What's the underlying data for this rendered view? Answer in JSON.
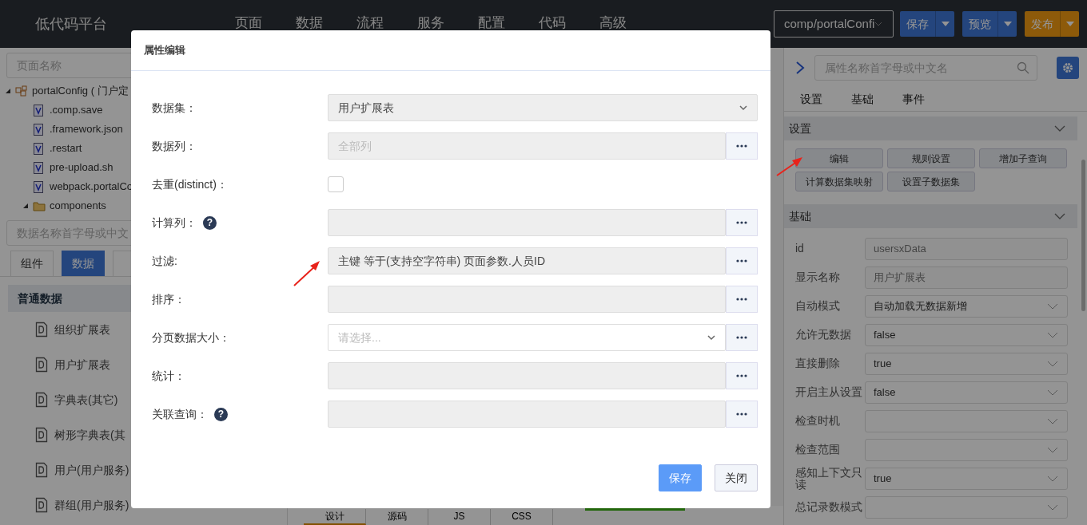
{
  "topbar": {
    "title": "低代码平台",
    "menu": [
      {
        "label": "页面"
      },
      {
        "label": "数据"
      },
      {
        "label": "流程"
      },
      {
        "label": "服务"
      },
      {
        "label": "配置"
      },
      {
        "label": "代码"
      },
      {
        "label": "高级"
      }
    ],
    "path_select": "comp/portalConfi",
    "actions": [
      {
        "label": "保存",
        "kind": "primary"
      },
      {
        "label": "预览",
        "kind": "primary"
      },
      {
        "label": "发布",
        "kind": "warning"
      }
    ]
  },
  "left_panel": {
    "page_search": {
      "placeholder": "页面名称"
    },
    "tree": [
      {
        "label": "portalConfig ( 门户定",
        "kind": "package",
        "expanded": true,
        "children": [
          {
            "label": ".comp.save",
            "kind": "file"
          },
          {
            "label": ".framework.json",
            "kind": "file"
          },
          {
            "label": ".restart",
            "kind": "file"
          },
          {
            "label": "pre-upload.sh",
            "kind": "file"
          },
          {
            "label": "webpack.portalCo",
            "kind": "file"
          },
          {
            "label": "components",
            "kind": "folder",
            "expanded": true
          }
        ]
      }
    ],
    "data_search": {
      "placeholder": "数据名称首字母或中文"
    },
    "tabs": [
      {
        "label": "组件",
        "selected": false
      },
      {
        "label": "数据",
        "selected": true
      },
      {
        "selected": false
      }
    ],
    "group": "普通数据",
    "items": [
      {
        "label": "组织扩展表"
      },
      {
        "label": "用户扩展表"
      },
      {
        "label": "字典表(其它)"
      },
      {
        "label": "树形字典表(其"
      },
      {
        "label": "用户(用户服务)"
      },
      {
        "label": "群组(用户服务)"
      }
    ]
  },
  "editor_tabs": [
    {
      "label": "设计",
      "selected": true
    },
    {
      "label": "源码",
      "selected": false
    },
    {
      "label": "JS",
      "selected": false
    },
    {
      "label": "CSS",
      "selected": false
    }
  ],
  "right_panel": {
    "search": {
      "placeholder": "属性名称首字母或中文名"
    },
    "tabs": [
      {
        "label": "设置"
      },
      {
        "label": "基础"
      },
      {
        "label": "事件"
      }
    ],
    "settings_section": {
      "title": "设置",
      "expanded": true,
      "buttons": [
        {
          "label": "编辑"
        },
        {
          "label": "规则设置"
        },
        {
          "label": "增加子查询"
        },
        {
          "label": "计算数据集映射"
        },
        {
          "label": "设置子数据集"
        }
      ]
    },
    "basic_section": {
      "title": "基础",
      "expanded": true,
      "properties": [
        {
          "label": "id",
          "kind": "input",
          "value": "usersxData",
          "readonly": true
        },
        {
          "label": "显示名称",
          "kind": "input",
          "value": "用户扩展表",
          "readonly": true
        },
        {
          "label": "自动模式",
          "kind": "select",
          "value": "自动加载无数据新增"
        },
        {
          "label": "允许无数据",
          "kind": "select",
          "value": "false"
        },
        {
          "label": "直接删除",
          "kind": "select",
          "value": "true"
        },
        {
          "label": "开启主从设置",
          "kind": "select",
          "value": "false"
        },
        {
          "label": "检查时机",
          "kind": "select"
        },
        {
          "label": "检查范围",
          "kind": "select"
        },
        {
          "label": "感知上下文只读",
          "kind": "select",
          "value": "true"
        },
        {
          "label": "总记录数模式",
          "kind": "select"
        }
      ]
    }
  },
  "dialog": {
    "title": "属性编辑",
    "rows": [
      {
        "label": "数据集：",
        "kind": "select",
        "value": "用户扩展表"
      },
      {
        "label": "数据列：",
        "kind": "picker",
        "placeholder": "全部列"
      },
      {
        "label": "去重(distinct)：",
        "kind": "checkbox",
        "checked": false
      },
      {
        "label": "计算列：",
        "kind": "picker",
        "help": "?"
      },
      {
        "label": "过滤:",
        "kind": "picker",
        "value": "主键 等于(支持空字符串) 页面参数.人员ID"
      },
      {
        "label": "排序：",
        "kind": "picker"
      },
      {
        "label": "分页数据大小：",
        "kind": "select_picker",
        "placeholder": "请选择..."
      },
      {
        "label": "统计：",
        "kind": "picker"
      },
      {
        "label": "关联查询：",
        "kind": "picker",
        "help": "?"
      }
    ],
    "buttons": [
      {
        "label": "保存",
        "kind": "primary"
      },
      {
        "label": "关闭",
        "kind": "secondary"
      }
    ]
  }
}
